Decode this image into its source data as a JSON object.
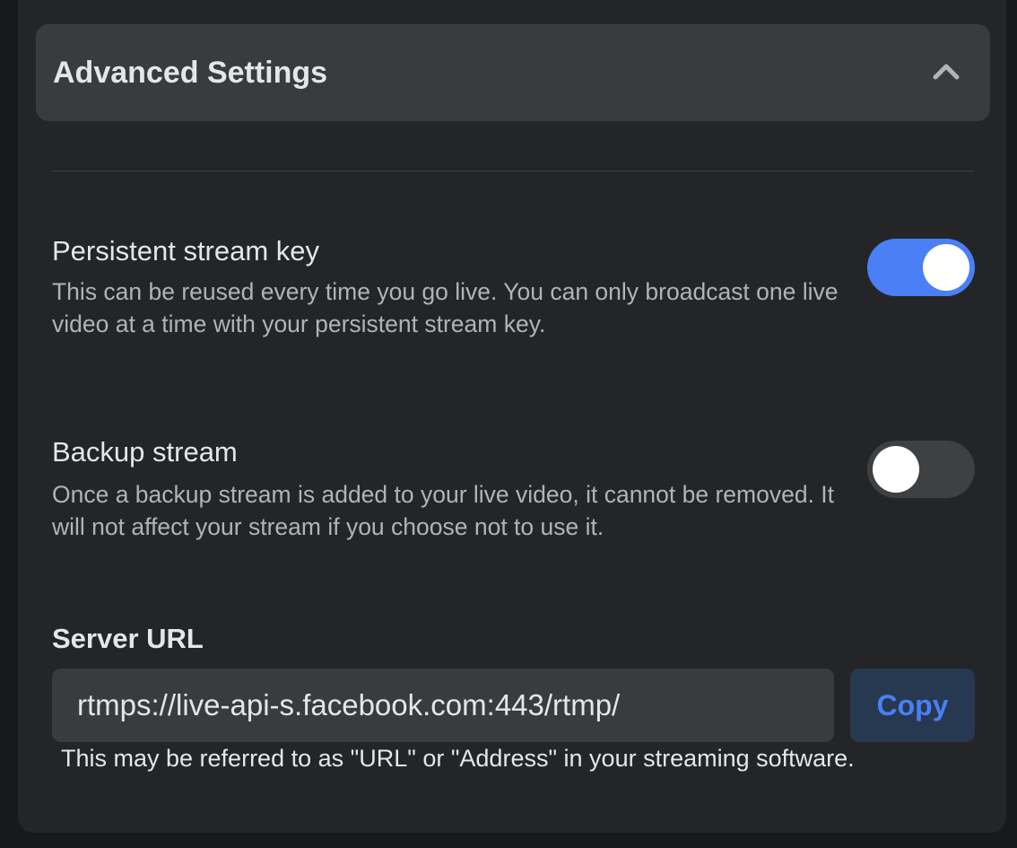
{
  "accordion": {
    "title": "Advanced Settings",
    "expanded": true,
    "icon": "chevron-up-icon"
  },
  "settings": [
    {
      "title": "Persistent stream key",
      "description": "This can be reused every time you go live. You can only broadcast one live video at a time with your persistent stream key.",
      "enabled": true
    },
    {
      "title": "Backup stream",
      "description": "Once a backup stream is added to your live video, it cannot be removed. It will not affect your stream if you choose not to use it.",
      "enabled": false
    }
  ],
  "server": {
    "label": "Server URL",
    "url": "rtmps://live-api-s.facebook.com:443/rtmp/",
    "copy_label": "Copy",
    "hint": "This may be referred to as \"URL\" or \"Address\" in your streaming software."
  },
  "colors": {
    "background": "#18191a",
    "card": "#242526",
    "surface": "#3a3b3c",
    "accent": "#4a7ff6",
    "text_primary": "#e4e6eb",
    "text_secondary": "#b0b3b8"
  }
}
